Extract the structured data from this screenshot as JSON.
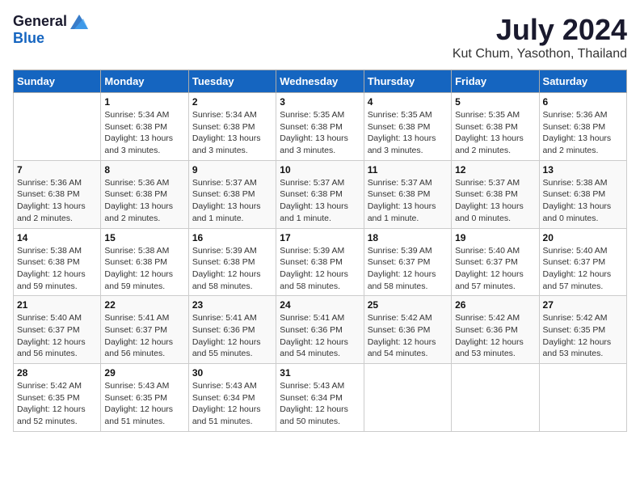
{
  "logo": {
    "general": "General",
    "blue": "Blue"
  },
  "title": "July 2024",
  "subtitle": "Kut Chum, Yasothon, Thailand",
  "days_header": [
    "Sunday",
    "Monday",
    "Tuesday",
    "Wednesday",
    "Thursday",
    "Friday",
    "Saturday"
  ],
  "weeks": [
    [
      {
        "day": "",
        "sunrise": "",
        "sunset": "",
        "daylight": ""
      },
      {
        "day": "1",
        "sunrise": "Sunrise: 5:34 AM",
        "sunset": "Sunset: 6:38 PM",
        "daylight": "Daylight: 13 hours and 3 minutes."
      },
      {
        "day": "2",
        "sunrise": "Sunrise: 5:34 AM",
        "sunset": "Sunset: 6:38 PM",
        "daylight": "Daylight: 13 hours and 3 minutes."
      },
      {
        "day": "3",
        "sunrise": "Sunrise: 5:35 AM",
        "sunset": "Sunset: 6:38 PM",
        "daylight": "Daylight: 13 hours and 3 minutes."
      },
      {
        "day": "4",
        "sunrise": "Sunrise: 5:35 AM",
        "sunset": "Sunset: 6:38 PM",
        "daylight": "Daylight: 13 hours and 3 minutes."
      },
      {
        "day": "5",
        "sunrise": "Sunrise: 5:35 AM",
        "sunset": "Sunset: 6:38 PM",
        "daylight": "Daylight: 13 hours and 2 minutes."
      },
      {
        "day": "6",
        "sunrise": "Sunrise: 5:36 AM",
        "sunset": "Sunset: 6:38 PM",
        "daylight": "Daylight: 13 hours and 2 minutes."
      }
    ],
    [
      {
        "day": "7",
        "sunrise": "Sunrise: 5:36 AM",
        "sunset": "Sunset: 6:38 PM",
        "daylight": "Daylight: 13 hours and 2 minutes."
      },
      {
        "day": "8",
        "sunrise": "Sunrise: 5:36 AM",
        "sunset": "Sunset: 6:38 PM",
        "daylight": "Daylight: 13 hours and 2 minutes."
      },
      {
        "day": "9",
        "sunrise": "Sunrise: 5:37 AM",
        "sunset": "Sunset: 6:38 PM",
        "daylight": "Daylight: 13 hours and 1 minute."
      },
      {
        "day": "10",
        "sunrise": "Sunrise: 5:37 AM",
        "sunset": "Sunset: 6:38 PM",
        "daylight": "Daylight: 13 hours and 1 minute."
      },
      {
        "day": "11",
        "sunrise": "Sunrise: 5:37 AM",
        "sunset": "Sunset: 6:38 PM",
        "daylight": "Daylight: 13 hours and 1 minute."
      },
      {
        "day": "12",
        "sunrise": "Sunrise: 5:37 AM",
        "sunset": "Sunset: 6:38 PM",
        "daylight": "Daylight: 13 hours and 0 minutes."
      },
      {
        "day": "13",
        "sunrise": "Sunrise: 5:38 AM",
        "sunset": "Sunset: 6:38 PM",
        "daylight": "Daylight: 13 hours and 0 minutes."
      }
    ],
    [
      {
        "day": "14",
        "sunrise": "Sunrise: 5:38 AM",
        "sunset": "Sunset: 6:38 PM",
        "daylight": "Daylight: 12 hours and 59 minutes."
      },
      {
        "day": "15",
        "sunrise": "Sunrise: 5:38 AM",
        "sunset": "Sunset: 6:38 PM",
        "daylight": "Daylight: 12 hours and 59 minutes."
      },
      {
        "day": "16",
        "sunrise": "Sunrise: 5:39 AM",
        "sunset": "Sunset: 6:38 PM",
        "daylight": "Daylight: 12 hours and 58 minutes."
      },
      {
        "day": "17",
        "sunrise": "Sunrise: 5:39 AM",
        "sunset": "Sunset: 6:38 PM",
        "daylight": "Daylight: 12 hours and 58 minutes."
      },
      {
        "day": "18",
        "sunrise": "Sunrise: 5:39 AM",
        "sunset": "Sunset: 6:37 PM",
        "daylight": "Daylight: 12 hours and 58 minutes."
      },
      {
        "day": "19",
        "sunrise": "Sunrise: 5:40 AM",
        "sunset": "Sunset: 6:37 PM",
        "daylight": "Daylight: 12 hours and 57 minutes."
      },
      {
        "day": "20",
        "sunrise": "Sunrise: 5:40 AM",
        "sunset": "Sunset: 6:37 PM",
        "daylight": "Daylight: 12 hours and 57 minutes."
      }
    ],
    [
      {
        "day": "21",
        "sunrise": "Sunrise: 5:40 AM",
        "sunset": "Sunset: 6:37 PM",
        "daylight": "Daylight: 12 hours and 56 minutes."
      },
      {
        "day": "22",
        "sunrise": "Sunrise: 5:41 AM",
        "sunset": "Sunset: 6:37 PM",
        "daylight": "Daylight: 12 hours and 56 minutes."
      },
      {
        "day": "23",
        "sunrise": "Sunrise: 5:41 AM",
        "sunset": "Sunset: 6:36 PM",
        "daylight": "Daylight: 12 hours and 55 minutes."
      },
      {
        "day": "24",
        "sunrise": "Sunrise: 5:41 AM",
        "sunset": "Sunset: 6:36 PM",
        "daylight": "Daylight: 12 hours and 54 minutes."
      },
      {
        "day": "25",
        "sunrise": "Sunrise: 5:42 AM",
        "sunset": "Sunset: 6:36 PM",
        "daylight": "Daylight: 12 hours and 54 minutes."
      },
      {
        "day": "26",
        "sunrise": "Sunrise: 5:42 AM",
        "sunset": "Sunset: 6:36 PM",
        "daylight": "Daylight: 12 hours and 53 minutes."
      },
      {
        "day": "27",
        "sunrise": "Sunrise: 5:42 AM",
        "sunset": "Sunset: 6:35 PM",
        "daylight": "Daylight: 12 hours and 53 minutes."
      }
    ],
    [
      {
        "day": "28",
        "sunrise": "Sunrise: 5:42 AM",
        "sunset": "Sunset: 6:35 PM",
        "daylight": "Daylight: 12 hours and 52 minutes."
      },
      {
        "day": "29",
        "sunrise": "Sunrise: 5:43 AM",
        "sunset": "Sunset: 6:35 PM",
        "daylight": "Daylight: 12 hours and 51 minutes."
      },
      {
        "day": "30",
        "sunrise": "Sunrise: 5:43 AM",
        "sunset": "Sunset: 6:34 PM",
        "daylight": "Daylight: 12 hours and 51 minutes."
      },
      {
        "day": "31",
        "sunrise": "Sunrise: 5:43 AM",
        "sunset": "Sunset: 6:34 PM",
        "daylight": "Daylight: 12 hours and 50 minutes."
      },
      {
        "day": "",
        "sunrise": "",
        "sunset": "",
        "daylight": ""
      },
      {
        "day": "",
        "sunrise": "",
        "sunset": "",
        "daylight": ""
      },
      {
        "day": "",
        "sunrise": "",
        "sunset": "",
        "daylight": ""
      }
    ]
  ]
}
